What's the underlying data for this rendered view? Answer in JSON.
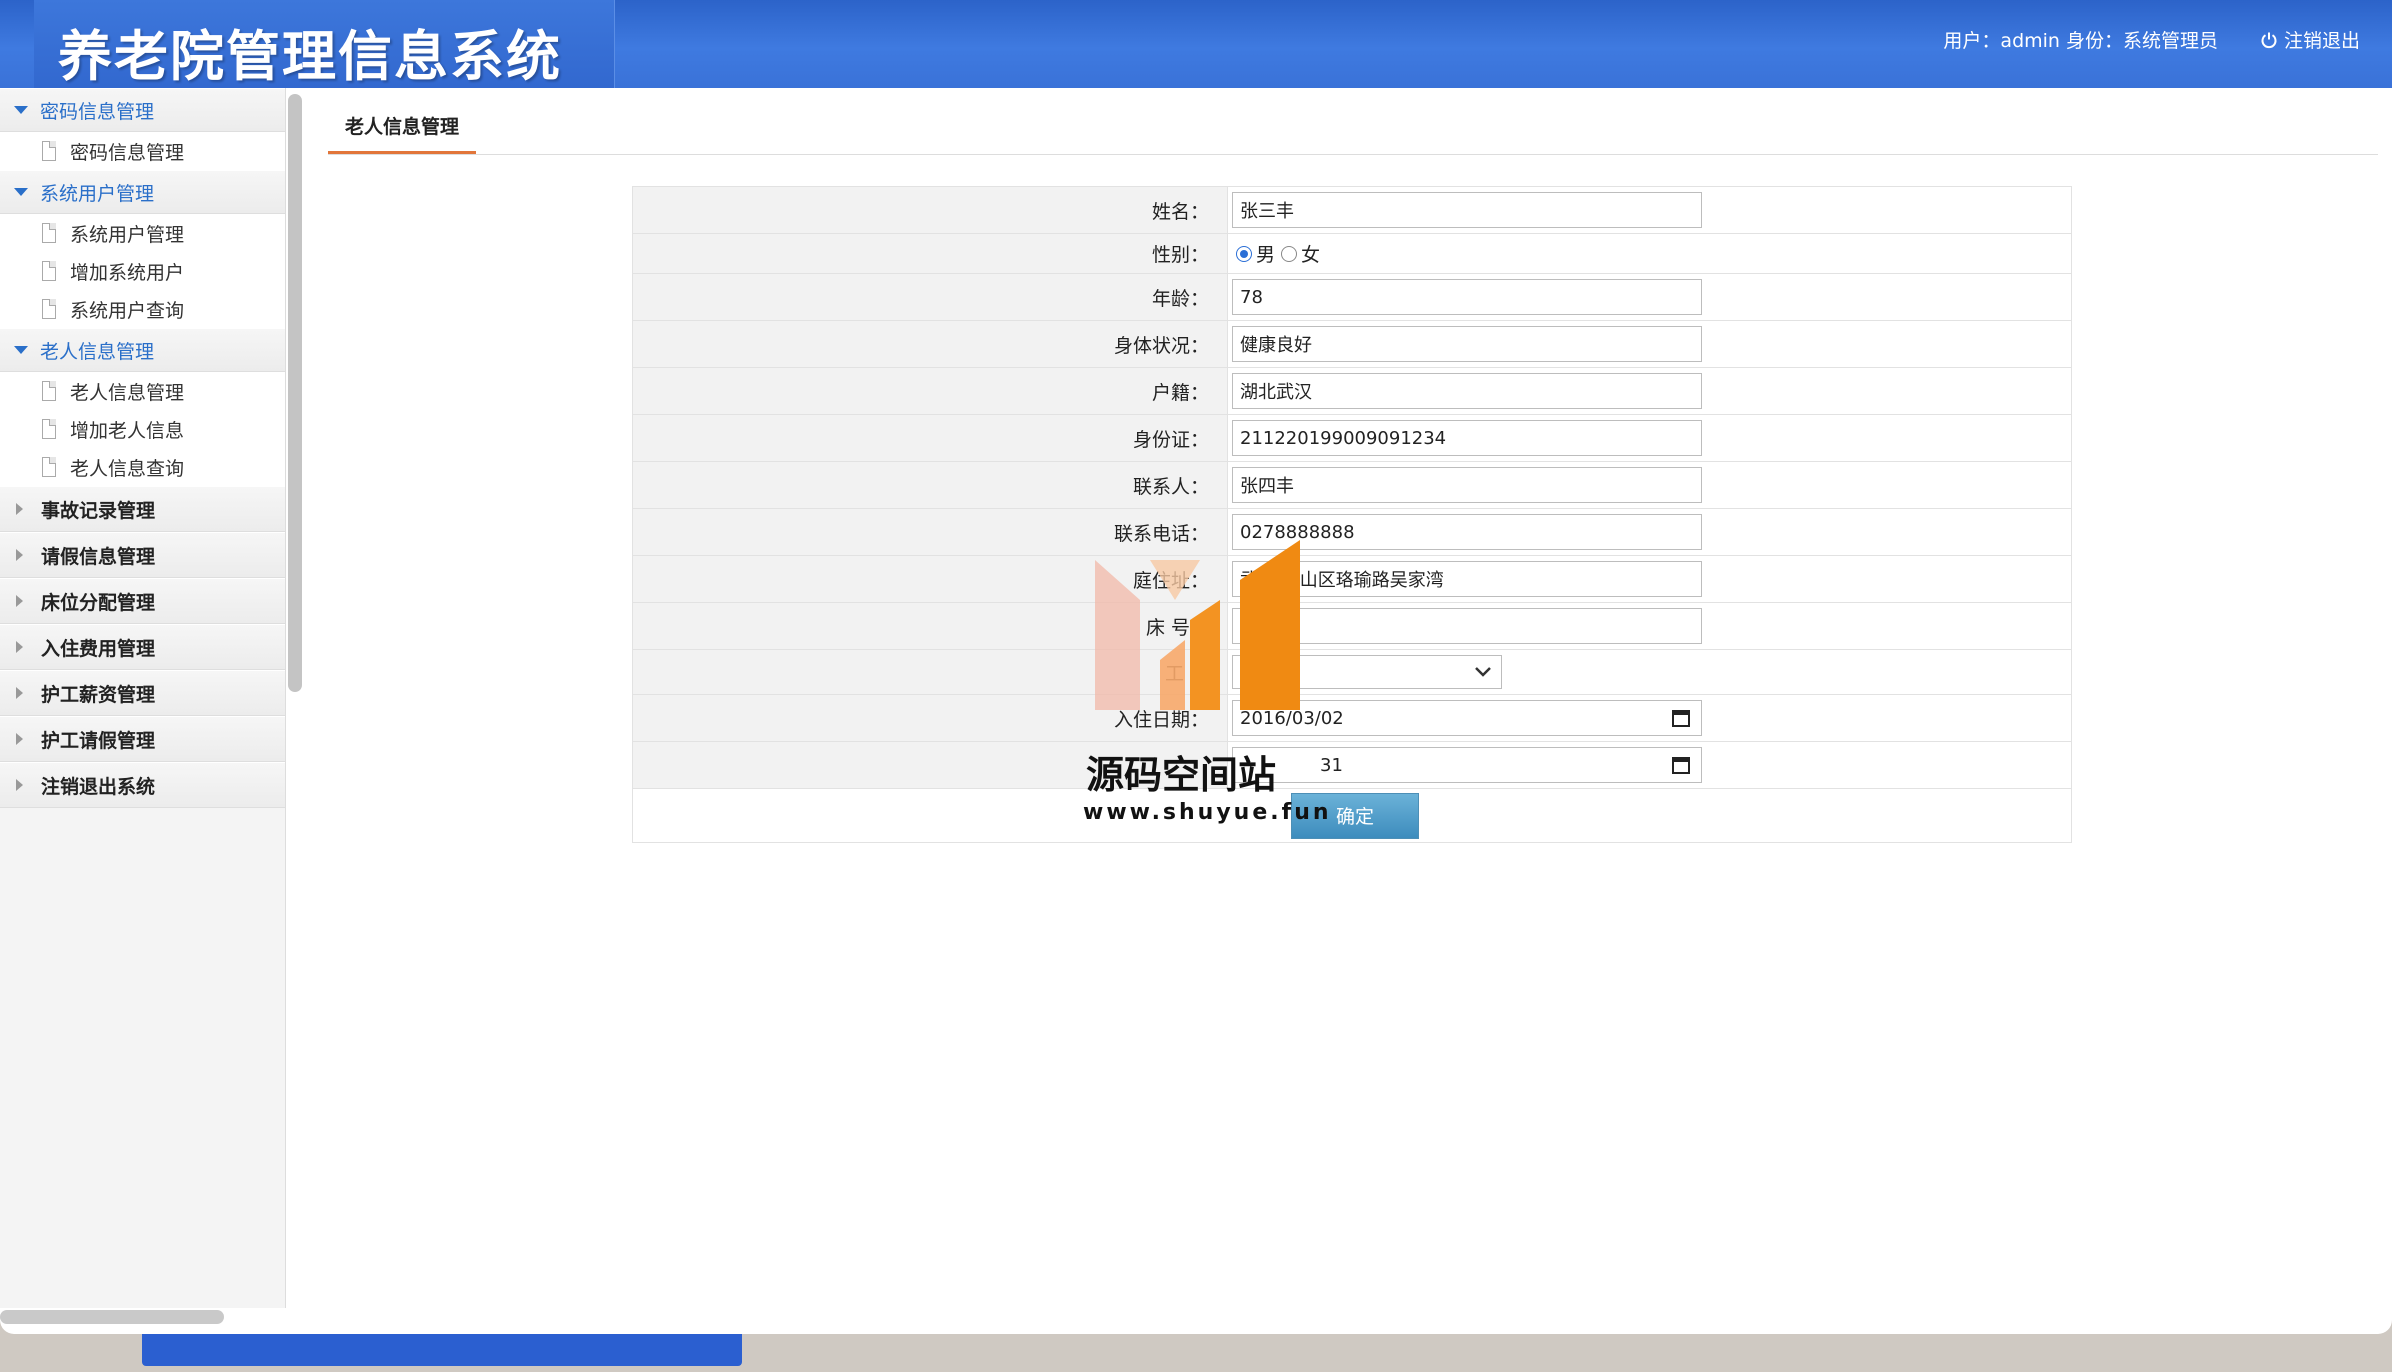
{
  "header": {
    "title": "养老院管理信息系统",
    "user_info": "用户：admin 身份：系统管理员",
    "logout_label": "注销退出"
  },
  "sidebar": {
    "groups": [
      {
        "label": "密码信息管理",
        "items": [
          {
            "label": "密码信息管理"
          }
        ]
      },
      {
        "label": "系统用户管理",
        "items": [
          {
            "label": "系统用户管理"
          },
          {
            "label": "增加系统用户"
          },
          {
            "label": "系统用户查询"
          }
        ]
      },
      {
        "label": "老人信息管理",
        "items": [
          {
            "label": "老人信息管理"
          },
          {
            "label": "增加老人信息"
          },
          {
            "label": "老人信息查询"
          }
        ]
      },
      {
        "label": "事故记录管理"
      },
      {
        "label": "请假信息管理"
      },
      {
        "label": "床位分配管理"
      },
      {
        "label": "入住费用管理"
      },
      {
        "label": "护工薪资管理"
      },
      {
        "label": "护工请假管理"
      },
      {
        "label": "注销退出系统"
      }
    ]
  },
  "main": {
    "tab_label": "老人信息管理",
    "form": {
      "name": {
        "label": "姓名：",
        "value": "张三丰"
      },
      "gender": {
        "label": "性别：",
        "male": "男",
        "female": "女",
        "selected": "男"
      },
      "age": {
        "label": "年龄：",
        "value": "78"
      },
      "health": {
        "label": "身体状况：",
        "value": "健康良好"
      },
      "hukou": {
        "label": "户籍：",
        "value": "湖北武汉"
      },
      "id_card": {
        "label": "身份证：",
        "value": "211220199009091234"
      },
      "contact": {
        "label": "联系人：",
        "value": "张四丰"
      },
      "phone": {
        "label": "联系电话：",
        "value": "0278888888"
      },
      "address": {
        "label": "庭住址：",
        "value": "武汉市 山区珞瑜路吴家湾"
      },
      "bed": {
        "label": "床 号：",
        "value": ""
      },
      "worker": {
        "label": "工 号",
        "value": ""
      },
      "checkin": {
        "label": "入住日期：",
        "value": "2016/03/02"
      },
      "checkout": {
        "label": "",
        "value": "31"
      },
      "submit_label": "确定"
    }
  },
  "watermark": {
    "title": "源码空间站",
    "url": "www.shuyue.fun"
  }
}
